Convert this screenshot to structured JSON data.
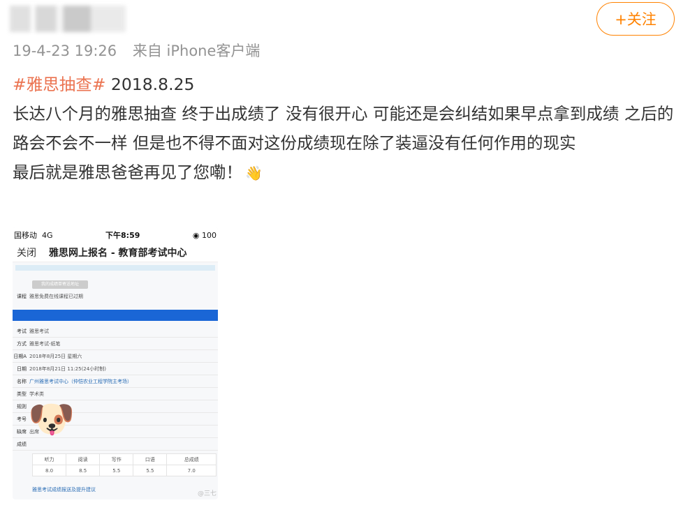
{
  "header": {
    "username_blurred": "",
    "follow_label": "+关注",
    "timestamp": "19-4-23 19:26",
    "source": "来自 iPhone客户端"
  },
  "post": {
    "hashtag": "#雅思抽查#",
    "date": "2018.8.25",
    "body": "长达八个月的雅思抽查 终于出成绩了 没有很开心 可能还是会纠结如果早点拿到成绩 之后的路会不会不一样 但是也不得不面对这份成绩现在除了装逼没有任何作用的现实",
    "closing": "最后就是雅思爸爸再见了您嘞！",
    "closing_emoji": "👋"
  },
  "screenshot": {
    "status": {
      "carrier": "国移动",
      "network": "4G",
      "time": "下午8:59",
      "battery": "100"
    },
    "nav": {
      "close": "关闭",
      "title": "雅思网上报名 - 教育部考试中心"
    },
    "button": "我的成绩单寄送地址",
    "course": {
      "key": "课程",
      "value": "雅思免费在线课程已过期"
    },
    "rows": [
      {
        "key": "考试",
        "value": "雅思考试",
        "link": false
      },
      {
        "key": "方式",
        "value": "雅思考试-纸笔",
        "link": false
      },
      {
        "key": "日期A",
        "value": "2018年8月25日 星期六",
        "link": false
      },
      {
        "key": "日期",
        "value": "2018年8月21日 11:25(24小时制)",
        "link": false
      },
      {
        "key": "名称",
        "value": "广州雅思考试中心（仲恺农业工程学院主考场）",
        "link": true
      },
      {
        "key": "类型",
        "value": "学术类",
        "link": false
      },
      {
        "key": "规则",
        "value": "",
        "link": false
      },
      {
        "key": "考号",
        "value": "",
        "link": false
      },
      {
        "key": "缺席",
        "value": "出席",
        "link": false
      },
      {
        "key": "成绩",
        "value": "",
        "link": false
      }
    ],
    "score_headers": [
      "听力",
      "阅读",
      "写作",
      "口语",
      "总成绩"
    ],
    "score_values": [
      "8.0",
      "8.5",
      "5.5",
      "5.5",
      "7.0"
    ],
    "bottom_link": "雅思考试成绩报送及提升建议",
    "watermark": "@三七",
    "sticker": "🐶"
  }
}
